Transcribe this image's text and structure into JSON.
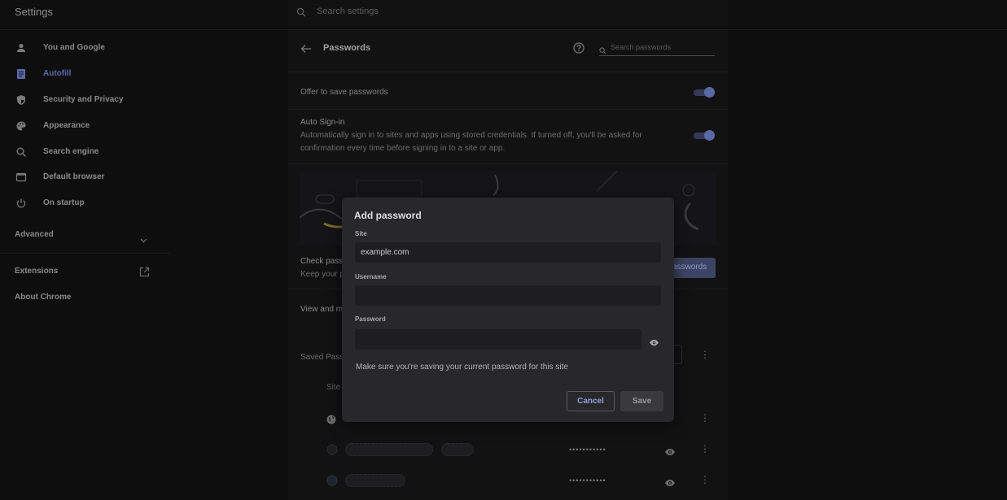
{
  "header": {
    "title": "Settings",
    "search_placeholder": "Search settings"
  },
  "sidebar": {
    "items": [
      {
        "label": "You and Google",
        "icon": "person-icon"
      },
      {
        "label": "Autofill",
        "icon": "autofill-icon",
        "active": true
      },
      {
        "label": "Security and Privacy",
        "icon": "shield-icon"
      },
      {
        "label": "Appearance",
        "icon": "palette-icon"
      },
      {
        "label": "Search engine",
        "icon": "search-icon"
      },
      {
        "label": "Default browser",
        "icon": "browser-icon"
      },
      {
        "label": "On startup",
        "icon": "power-icon"
      }
    ],
    "advanced": "Advanced",
    "extensions": "Extensions",
    "about": "About Chrome"
  },
  "passwords_page": {
    "title": "Passwords",
    "search_placeholder": "Search passwords",
    "offer_to_save": "Offer to save passwords",
    "auto_signin_title": "Auto Sign-in",
    "auto_signin_desc_1": "Automatically sign in to sites and apps using stored credentials. If turned off, you'll be asked for",
    "auto_signin_desc_2": "confirmation every time before signing in to a site or app.",
    "check_label": "Check pass",
    "keep_label": "Keep your p",
    "check_button": "asswords",
    "view_label": "View and m",
    "saved_label": "Saved Pass",
    "site_col": "Site",
    "masked_password": "•••••••••••"
  },
  "dialog": {
    "title": "Add password",
    "site_label": "Site",
    "site_value": "example.com",
    "username_label": "Username",
    "username_value": "",
    "password_label": "Password",
    "password_value": "",
    "note": "Make sure you're saving your current password for this site",
    "cancel": "Cancel",
    "save": "Save"
  },
  "colors": {
    "accent": "#5c6aa8",
    "dialog_bg": "#28282b",
    "page_bg": "#0e0e0f"
  }
}
